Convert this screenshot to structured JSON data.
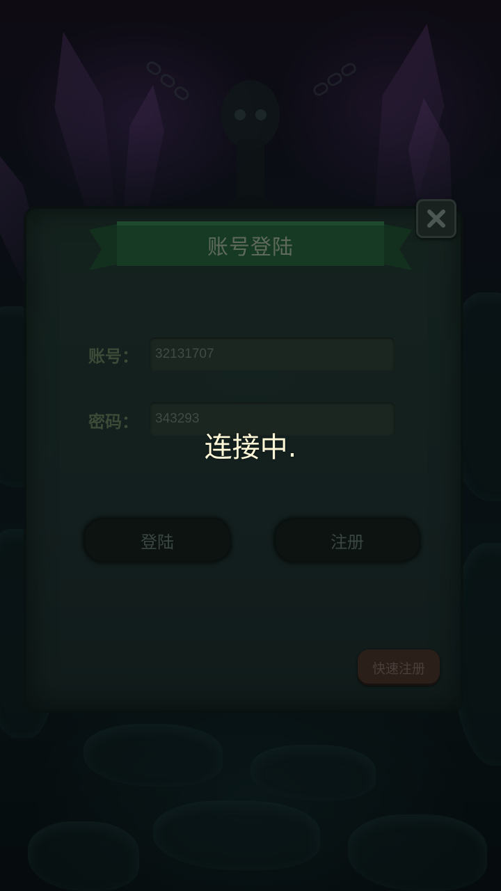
{
  "dialog": {
    "title": "账号登陆",
    "close_icon": "close-icon"
  },
  "form": {
    "account_label": "账号：",
    "account_value": "32131707",
    "password_label": "密码：",
    "password_value": "343293"
  },
  "buttons": {
    "login_label": "登陆",
    "register_label": "注册",
    "quick_register_label": "快速注册"
  },
  "status": {
    "connecting_text": "连接中."
  }
}
